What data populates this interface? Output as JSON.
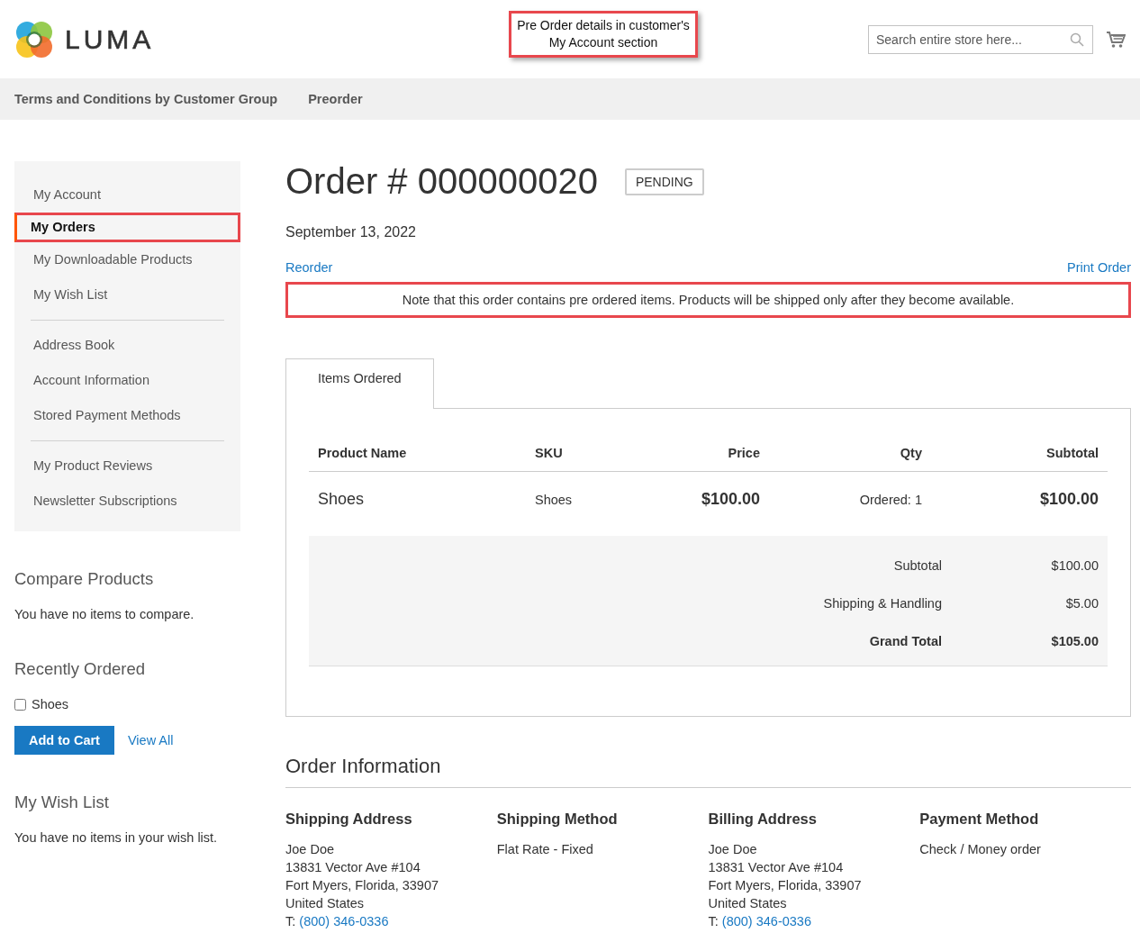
{
  "header": {
    "logo_text": "LUMA",
    "callout": {
      "lines": [
        "Pre Order details in customer's",
        "My Account section"
      ]
    },
    "search": {
      "placeholder": "Search entire store here..."
    }
  },
  "nav": {
    "items": [
      {
        "label": "Terms and Conditions by Customer Group"
      },
      {
        "label": "Preorder"
      }
    ]
  },
  "sidebar": {
    "groups": [
      {
        "items": [
          {
            "label": "My Account",
            "selected": false,
            "highlighted": false
          },
          {
            "label": "My Orders",
            "selected": true,
            "highlighted": true
          },
          {
            "label": "My Downloadable Products",
            "selected": false,
            "highlighted": false
          },
          {
            "label": "My Wish List",
            "selected": false,
            "highlighted": false
          }
        ]
      },
      {
        "items": [
          {
            "label": "Address Book",
            "selected": false,
            "highlighted": false
          },
          {
            "label": "Account Information",
            "selected": false,
            "highlighted": false
          },
          {
            "label": "Stored Payment Methods",
            "selected": false,
            "highlighted": false
          }
        ]
      },
      {
        "items": [
          {
            "label": "My Product Reviews",
            "selected": false,
            "highlighted": false
          },
          {
            "label": "Newsletter Subscriptions",
            "selected": false,
            "highlighted": false
          }
        ]
      }
    ]
  },
  "compare": {
    "title": "Compare Products",
    "text": "You have no items to compare."
  },
  "recently_ordered": {
    "title": "Recently Ordered",
    "items": [
      {
        "label": "Shoes",
        "checked": false
      }
    ],
    "add_button": "Add to Cart",
    "view_all": "View All"
  },
  "wishlist": {
    "title": "My Wish List",
    "text": "You have no items in your wish list."
  },
  "order": {
    "title": "Order # 000000020",
    "status": "PENDING",
    "date": "September 13, 2022",
    "reorder": "Reorder",
    "print": "Print Order",
    "note": "Note that this order contains pre ordered items. Products will be shipped only after they become available.",
    "tabs": [
      {
        "label": "Items Ordered",
        "selected": true
      }
    ],
    "table": {
      "columns": [
        "Product Name",
        "SKU",
        "Price",
        "Qty",
        "Subtotal"
      ],
      "rows": [
        {
          "name": "Shoes",
          "sku": "Shoes",
          "price": "$100.00",
          "qty": "Ordered: 1",
          "subtotal": "$100.00"
        }
      ],
      "totals": [
        {
          "label": "Subtotal",
          "value": "$100.00",
          "bold": false
        },
        {
          "label": "Shipping & Handling",
          "value": "$5.00",
          "bold": false
        },
        {
          "label": "Grand Total",
          "value": "$105.00",
          "bold": true
        }
      ]
    }
  },
  "order_information": {
    "title": "Order Information",
    "columns": [
      {
        "title": "Shipping Address",
        "lines": [
          {
            "kind": "text",
            "text": "Joe Doe"
          },
          {
            "kind": "text",
            "text": "13831 Vector Ave #104"
          },
          {
            "kind": "text",
            "text": "Fort Myers, Florida, 33907"
          },
          {
            "kind": "text",
            "text": "United States"
          },
          {
            "kind": "phone",
            "text": "T:",
            "link": "(800) 346-0336"
          }
        ]
      },
      {
        "title": "Shipping Method",
        "lines": [
          {
            "kind": "text",
            "text": "Flat Rate - Fixed"
          }
        ]
      },
      {
        "title": "Billing Address",
        "lines": [
          {
            "kind": "text",
            "text": "Joe Doe"
          },
          {
            "kind": "text",
            "text": "13831 Vector Ave #104"
          },
          {
            "kind": "text",
            "text": "Fort Myers, Florida, 33907"
          },
          {
            "kind": "text",
            "text": "United States"
          },
          {
            "kind": "phone",
            "text": "T:",
            "link": "(800) 346-0336"
          }
        ]
      },
      {
        "title": "Payment Method",
        "lines": [
          {
            "kind": "text",
            "text": "Check / Money order"
          }
        ]
      }
    ]
  }
}
